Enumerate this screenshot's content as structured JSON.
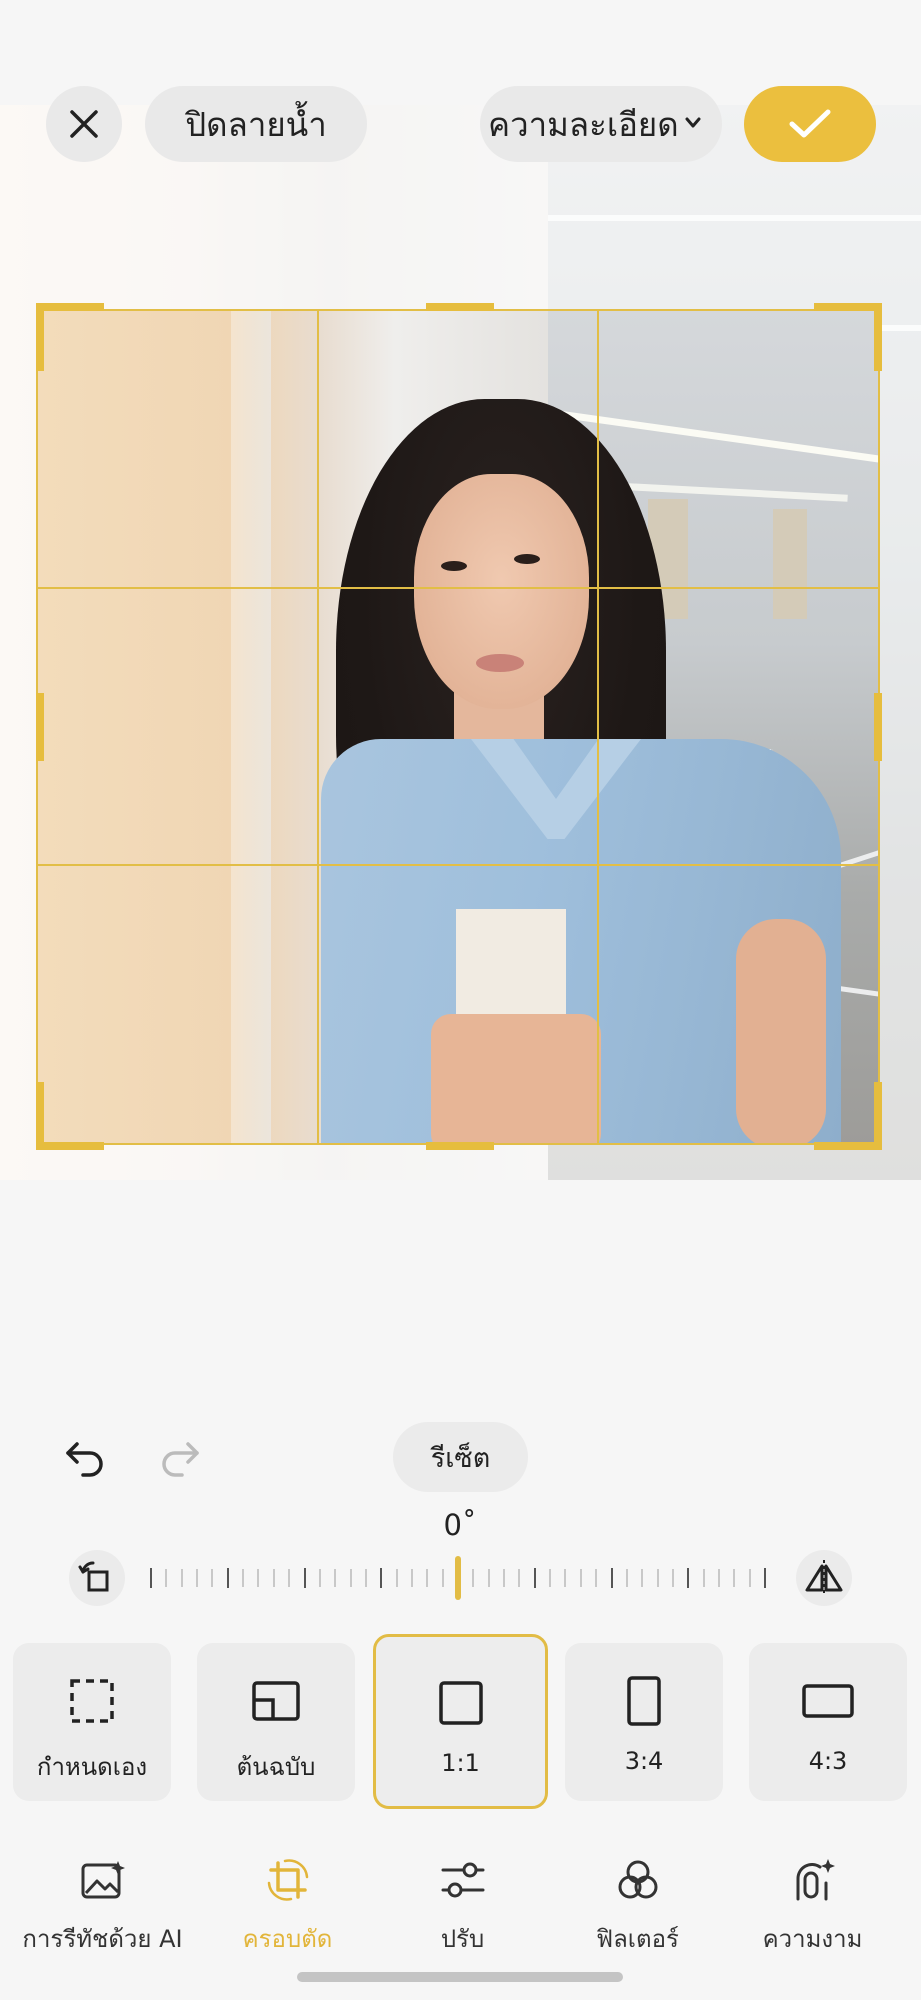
{
  "top_bar": {
    "close_icon": "close-icon",
    "watermark_label": "ปิดลายน้ำ",
    "quality_label": "ความละเอียด",
    "confirm_icon": "check-icon"
  },
  "crop": {
    "grid_color": "#e2be46",
    "reset_label": "รีเซ็ต",
    "angle_label": "0˚",
    "accent": "#e2bc45"
  },
  "ratios": [
    {
      "label": "กำหนดเอง",
      "icon": "freeform-crop-icon",
      "selected": false
    },
    {
      "label": "ต้นฉบับ",
      "icon": "original-ratio-icon",
      "selected": false
    },
    {
      "label": "1:1",
      "icon": "square-ratio-icon",
      "selected": true
    },
    {
      "label": "3:4",
      "icon": "portrait-ratio-icon",
      "selected": false
    },
    {
      "label": "4:3",
      "icon": "landscape-ratio-icon",
      "selected": false
    }
  ],
  "nav": [
    {
      "label": "การรีทัชด้วย AI",
      "icon": "ai-retouch-icon",
      "active": false
    },
    {
      "label": "ครอบตัด",
      "icon": "crop-icon",
      "active": true
    },
    {
      "label": "ปรับ",
      "icon": "adjust-sliders-icon",
      "active": false
    },
    {
      "label": "ฟิลเตอร์",
      "icon": "filter-icon",
      "active": false
    },
    {
      "label": "ความงาม",
      "icon": "beauty-icon",
      "active": false
    }
  ]
}
